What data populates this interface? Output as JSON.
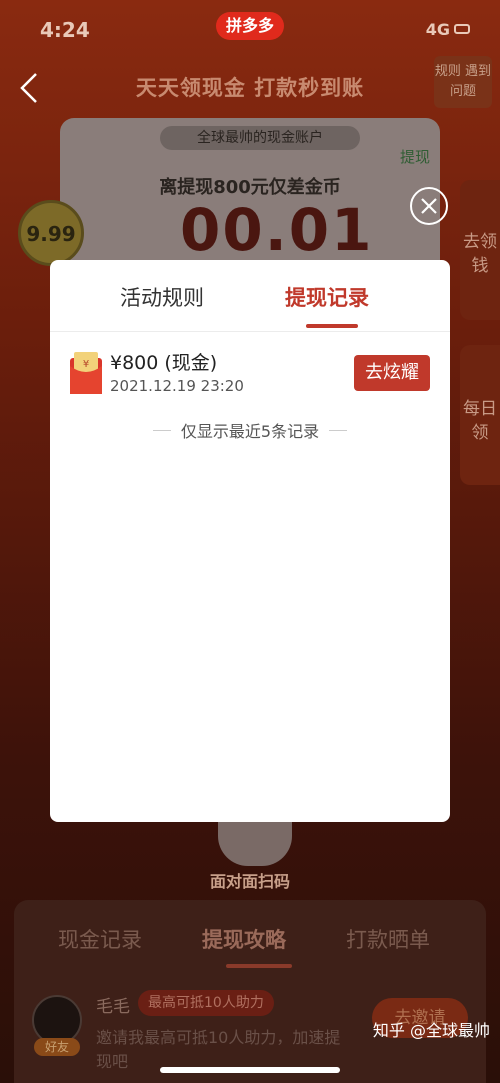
{
  "status_bar": {
    "time": "4:24",
    "network": "4G"
  },
  "app_logo": "拼多多",
  "header": {
    "title": "天天领现金 打款秒到账",
    "rules_tag": "规则 遇到问题"
  },
  "cash_card": {
    "account_label": "全球最帅的现金账户",
    "withdraw_link": "提现",
    "difference_text": "离提现800元仅差金币",
    "amount": "00.01",
    "coin_badge": "9.99"
  },
  "side_tabs": [
    {
      "label": "去领钱"
    },
    {
      "label": "每日领"
    }
  ],
  "qr": {
    "label": "面对面扫码"
  },
  "bottom_panel": {
    "tabs": [
      "现金记录",
      "提现攻略",
      "打款晒单"
    ],
    "active_tab": "提现攻略",
    "friend": {
      "name": "毛毛",
      "help_tag": "最高可抵10人助力",
      "invite_text": "邀请我最高可抵10人助力，加速提现吧",
      "avatar_tag": "好友",
      "invite_button": "去邀请"
    }
  },
  "modal": {
    "tabs": [
      "活动规则",
      "提现记录"
    ],
    "active_tab": "提现记录",
    "records": [
      {
        "amount": "¥800 (现金)",
        "date": "2021.12.19 23:20",
        "action": "去炫耀"
      }
    ],
    "footer_note": "仅显示最近5条记录"
  },
  "watermark": "知乎 @全球最帅",
  "colors": {
    "accent": "#c0392b",
    "overlay": "#2a0f08"
  }
}
